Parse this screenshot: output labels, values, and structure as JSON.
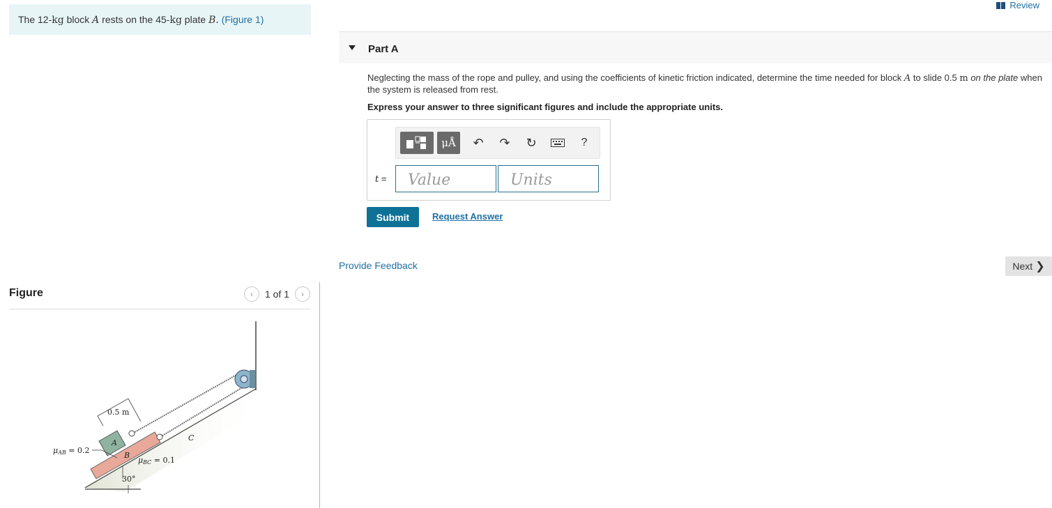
{
  "problem": {
    "text_prefix": "The 12-",
    "kg1": "kg",
    "text_mid": " block ",
    "block_a": "A",
    "text_mid2": " rests on the 45-",
    "kg2": "kg",
    "text_mid3": " plate ",
    "plate_b": "B.",
    "figure_link": "(Figure 1)"
  },
  "figure_panel": {
    "title": "Figure",
    "pager_text": "1 of 1",
    "prev_icon": "chevron-left-icon",
    "next_icon": "chevron-right-icon"
  },
  "figure_labels": {
    "dim": "0.5 m",
    "block_a": "A",
    "plate_b": "B",
    "point_c": "C",
    "mu_ab": "μ",
    "mu_ab_sub": "AB",
    "mu_ab_val": " = 0.2",
    "mu_bc": "μ",
    "mu_bc_sub": "BC",
    "mu_bc_val": " = 0.1",
    "angle": "30°"
  },
  "header": {
    "review_label": "Review",
    "review_icon": "book-icon"
  },
  "part": {
    "title": "Part A",
    "caret_icon": "caret-down-icon",
    "question_1": "Neglecting the mass of the rope and pulley, and using the coefficients of kinetic friction indicated, determine the time needed for block ",
    "question_a": "A",
    "question_2": " to slide 0.5 ",
    "question_m": "m",
    "question_3": " ",
    "question_ital": "on the plate",
    "question_4": " when the system is released from rest.",
    "instruction": "Express your answer to three significant figures and include the appropriate units."
  },
  "answer": {
    "variable": "t",
    "equals": " =",
    "value_placeholder": "Value",
    "units_placeholder": "Units",
    "toolbar": {
      "template_icon": "template-icon",
      "units_button": "μÅ",
      "undo_icon": "undo-icon",
      "redo_icon": "redo-icon",
      "reset_icon": "reset-icon",
      "keyboard_icon": "keyboard-icon",
      "help_label": "?"
    }
  },
  "actions": {
    "submit": "Submit",
    "request_answer": "Request Answer",
    "provide_feedback": "Provide Feedback",
    "next": "Next",
    "next_icon": "chevron-right-icon"
  }
}
